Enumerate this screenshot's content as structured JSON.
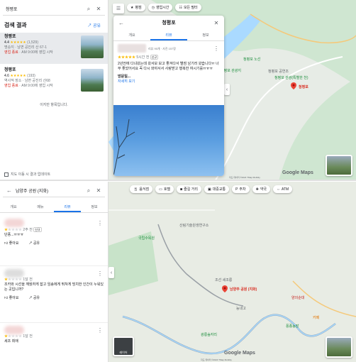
{
  "top": {
    "search": {
      "query": "청평포"
    },
    "results": {
      "title": "검색 결과",
      "share_label": "공유",
      "items": [
        {
          "name": "청평포",
          "rating": "4.4",
          "reviews": "(1,529)",
          "category": "명승지 · 남면 공진리 산 67-1",
          "status": "영업 종료",
          "hours": " · AM 9:00에 영업 시작"
        },
        {
          "name": "청평포",
          "rating": "4.6",
          "reviews": "(193)",
          "category": "역사적 장소 · 남면 공진리 산68",
          "status": "영업 종료",
          "hours": " · AM 9:00에 영업 시작"
        }
      ],
      "end_text": "이지만 항목입니다.",
      "update_label": "지도 이동 시 결과 업데이트"
    },
    "chips": [
      "평점",
      "영업시간",
      "모든 필터"
    ],
    "detail": {
      "title": "청평포",
      "tabs": [
        "개요",
        "리뷰",
        "정보"
      ],
      "review_meta": "리뷰 90개 · 사진 157장",
      "review_date": "5시간 전",
      "review_badge": "신규",
      "review_text": "2년전에 다녀왔는데 왔서보 보고 좋겨다서 별점 남기러 왔습니다ㅠ 너무 좋았어서요 꼭 다시 와야서서 사랑받고 행복한 여시기를ㅠㅠㅠ",
      "visit_label": "방문일...",
      "more_label": "자세히 보기"
    },
    "map": {
      "labels": [
        "청평포 관광지",
        "청평포 관광소",
        "청평포 관광(특별한 천)",
        "청평포 공연조",
        "청평포 노선",
        "청평포"
      ],
      "brand": "Google Maps",
      "copyright": "지도 데이터 ©2024 TMap Mobility"
    }
  },
  "bottom": {
    "search": {
      "query": "남양주 공원 (지화)"
    },
    "tabs": [
      "개요",
      "메뉴",
      "리뷰",
      "정보"
    ],
    "reviews": [
      {
        "date": "2주 전",
        "badge": "신규",
        "text": "단풍...ㅠㅠㅠ",
        "like": "좋아요",
        "share": "공유"
      },
      {
        "date": "1달 전",
        "badge": "",
        "text": "조카와 시선을 깨웠하게 잡고 임송에게 뛰쳐게 빙치한 인간이 누워있는 곳입니까?",
        "like": "좋아요",
        "share": "공유"
      },
      {
        "date": "1달 전",
        "badge": "",
        "text": "세조 최애",
        "like": "좋아요",
        "share": "공유"
      }
    ],
    "chips": [
      "음식점",
      "호텔",
      "즐길 거리",
      "대중교통",
      "주차",
      "약국",
      "ATM"
    ],
    "map": {
      "pin_label": "남양주 공원 (지화)",
      "labels": [
        "국립수목원",
        "산림기술원생연구소",
        "조선 세조릉",
        "능내고",
        "풍종농장",
        "양의순대",
        "카페",
        "광릉숲자리"
      ],
      "brand": "Google Maps",
      "copyright": "지도 데이터 ©2024 TMap Mobility",
      "layers_label": "레이어"
    }
  }
}
